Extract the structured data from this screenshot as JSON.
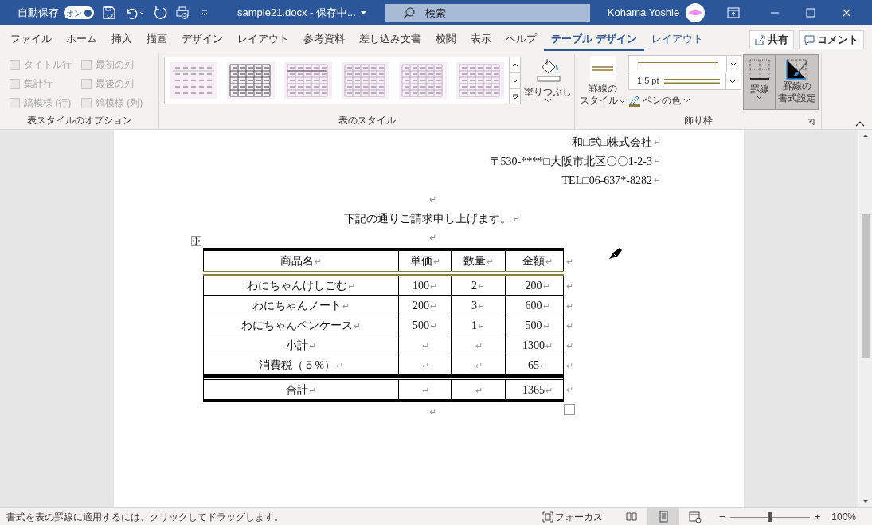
{
  "title_bar": {
    "autosave_label": "自動保存",
    "autosave_toggle": {
      "text": "オン",
      "on": true
    },
    "document_title": "sample21.docx - 保存中...",
    "search_placeholder": "検索",
    "user_name": "Kohama Yoshie"
  },
  "tabs": [
    {
      "label": "ファイル",
      "selected": false,
      "kind": "normal"
    },
    {
      "label": "ホーム",
      "selected": false,
      "kind": "normal"
    },
    {
      "label": "挿入",
      "selected": false,
      "kind": "normal"
    },
    {
      "label": "描画",
      "selected": false,
      "kind": "normal"
    },
    {
      "label": "デザイン",
      "selected": false,
      "kind": "normal"
    },
    {
      "label": "レイアウト",
      "selected": false,
      "kind": "normal"
    },
    {
      "label": "参考資料",
      "selected": false,
      "kind": "normal"
    },
    {
      "label": "差し込み文書",
      "selected": false,
      "kind": "normal"
    },
    {
      "label": "校閲",
      "selected": false,
      "kind": "normal"
    },
    {
      "label": "表示",
      "selected": false,
      "kind": "normal"
    },
    {
      "label": "ヘルプ",
      "selected": false,
      "kind": "normal"
    },
    {
      "label": "テーブル デザイン",
      "selected": true,
      "kind": "contextual"
    },
    {
      "label": "レイアウト",
      "selected": false,
      "kind": "contextual"
    }
  ],
  "share_button": "共有",
  "comment_button": "コメント",
  "style_options": {
    "label": "表スタイルのオプション",
    "options": [
      {
        "label": "タイトル行",
        "checked": false,
        "disabled": true
      },
      {
        "label": "最初の列",
        "checked": false,
        "disabled": true
      },
      {
        "label": "集計行",
        "checked": false,
        "disabled": true
      },
      {
        "label": "最後の列",
        "checked": false,
        "disabled": true
      },
      {
        "label": "縞模様 (行)",
        "checked": false,
        "disabled": true
      },
      {
        "label": "縞模様 (列)",
        "checked": false,
        "disabled": true
      }
    ]
  },
  "table_styles": {
    "label": "表のスタイル",
    "styles": [
      {
        "kind": "plain"
      },
      {
        "kind": "grid-dark"
      },
      {
        "kind": "grid-header"
      },
      {
        "kind": "grid-light"
      },
      {
        "kind": "grid-light"
      },
      {
        "kind": "grid-light"
      }
    ],
    "shading_button": "塗りつぶし"
  },
  "borders": {
    "label": "飾り枠",
    "border_styles_button": [
      "罫線の",
      "スタイル"
    ],
    "line_weight": "1.5 pt",
    "pen_color_button": "ペンの色",
    "borders_button": {
      "label": "罫線",
      "pressed": true
    },
    "border_painter_button": {
      "lines": [
        "罫線の",
        "書式設定"
      ],
      "pressed": true
    }
  },
  "document": {
    "paragraphs_before": [
      {
        "kind": "right",
        "text": "和□弐□株式会社",
        "mark": "↵"
      },
      {
        "kind": "right",
        "text": "〒530-****□大阪市北区〇〇1-2-3",
        "mark": "↵"
      },
      {
        "kind": "right",
        "text": "TEL□06-637*-8282",
        "mark": "↵"
      },
      {
        "kind": "center",
        "mark": "↵"
      },
      {
        "kind": "center",
        "text": "下記の通りご請求申し上げます。",
        "mark": "↵"
      },
      {
        "kind": "center",
        "mark": "↵"
      }
    ],
    "table": {
      "rows": [
        {
          "kind": "header",
          "cells": [
            {
              "text": "商品名",
              "mark": "↵"
            },
            {
              "text": "単価",
              "mark": "↵"
            },
            {
              "text": "数量",
              "mark": "↵"
            },
            {
              "text": "金額",
              "mark": "↵"
            }
          ],
          "end_mark": "↵"
        },
        {
          "kind": "body",
          "cells": [
            {
              "text": "わにちゃんけしごむ",
              "mark": "↵"
            },
            {
              "text": "100",
              "mark": "↵"
            },
            {
              "text": "2",
              "mark": "↵"
            },
            {
              "text": "200",
              "mark": "↵"
            }
          ],
          "end_mark": "↵"
        },
        {
          "kind": "body",
          "cells": [
            {
              "text": "わにちゃんノート",
              "mark": "↵"
            },
            {
              "text": "200",
              "mark": "↵"
            },
            {
              "text": "3",
              "mark": "↵"
            },
            {
              "text": "600",
              "mark": "↵"
            }
          ],
          "end_mark": "↵"
        },
        {
          "kind": "body",
          "cells": [
            {
              "text": "わにちゃんペンケース",
              "mark": "↵"
            },
            {
              "text": "500",
              "mark": "↵"
            },
            {
              "text": "1",
              "mark": "↵"
            },
            {
              "text": "500",
              "mark": "↵"
            }
          ],
          "end_mark": "↵"
        },
        {
          "kind": "body",
          "cells": [
            {
              "text": "小計",
              "mark": "↵"
            },
            {
              "mark": "↵"
            },
            {
              "mark": "↵"
            },
            {
              "text": "1300",
              "mark": "↵"
            }
          ],
          "end_mark": "↵"
        },
        {
          "kind": "body",
          "cells": [
            {
              "text": "消費税（５%）",
              "mark": "↵"
            },
            {
              "mark": "↵"
            },
            {
              "mark": "↵"
            },
            {
              "text": "65",
              "mark": "↵"
            }
          ],
          "end_mark": "↵"
        },
        {
          "kind": "total",
          "cells": [
            {
              "text": "合計",
              "mark": "↵"
            },
            {
              "mark": "↵"
            },
            {
              "mark": "↵"
            },
            {
              "text": "1365",
              "mark": "↵"
            }
          ],
          "end_mark": "↵"
        }
      ]
    },
    "paragraphs_after": [
      {
        "kind": "center",
        "mark": "↵"
      }
    ]
  },
  "status_bar": {
    "message": "書式を表の罫線に適用するには、クリックしてドラッグします。",
    "focus": "フォーカス",
    "views": [
      {
        "kind": "read",
        "selected": false
      },
      {
        "kind": "print",
        "selected": true
      },
      {
        "kind": "web",
        "selected": false
      }
    ],
    "zoom": {
      "minus": "−",
      "plus": "+",
      "level": 0.5,
      "percent": "100%"
    }
  }
}
